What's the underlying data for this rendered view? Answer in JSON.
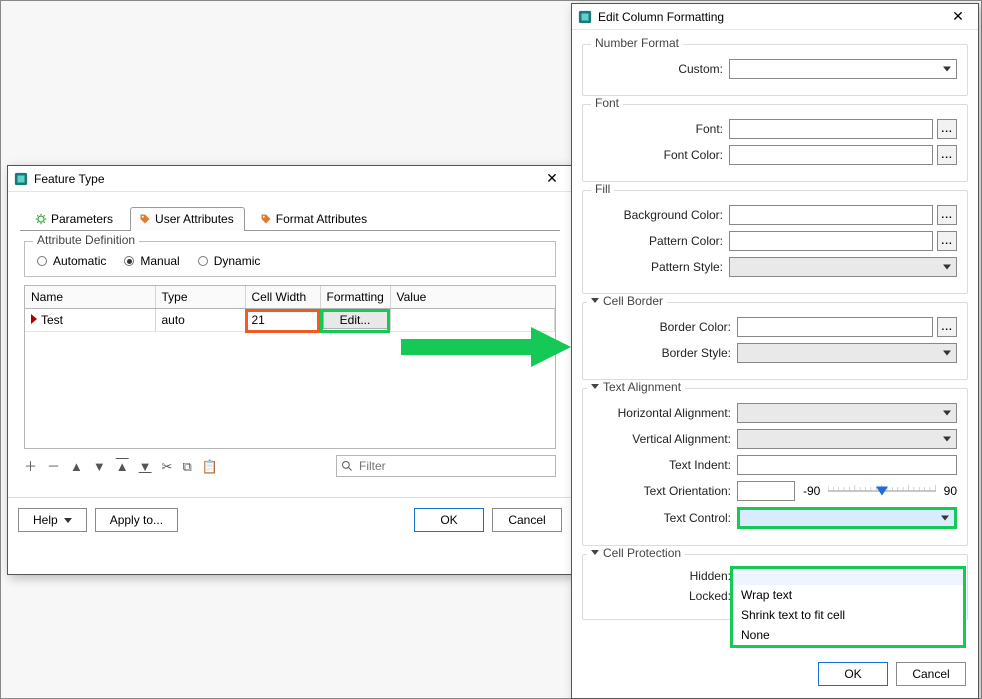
{
  "feature_type": {
    "title": "Feature Type",
    "tabs": {
      "parameters": "Parameters",
      "user_attributes": "User Attributes",
      "format_attributes": "Format Attributes",
      "active": "user_attributes"
    },
    "attr_def": {
      "legend": "Attribute Definition",
      "modes": {
        "automatic": "Automatic",
        "manual": "Manual",
        "dynamic": "Dynamic"
      },
      "selected": "manual"
    },
    "table": {
      "columns": {
        "name": "Name",
        "type": "Type",
        "cell_width": "Cell Width",
        "formatting": "Formatting",
        "value": "Value"
      },
      "rows": [
        {
          "name": "Test",
          "type": "auto",
          "cell_width": "21",
          "formatting": "Edit..."
        }
      ]
    },
    "filter_placeholder": "Filter",
    "buttons": {
      "help": "Help",
      "apply_to": "Apply to...",
      "ok": "OK",
      "cancel": "Cancel"
    }
  },
  "ecf": {
    "title": "Edit Column Formatting",
    "sections": {
      "number_format": {
        "title": "Number Format",
        "custom_label": "Custom:"
      },
      "font": {
        "title": "Font",
        "font_label": "Font:",
        "font_color_label": "Font Color:"
      },
      "fill": {
        "title": "Fill",
        "bg_label": "Background Color:",
        "pat_color_label": "Pattern Color:",
        "pat_style_label": "Pattern Style:"
      },
      "cell_border": {
        "title": "Cell Border",
        "border_color_label": "Border Color:",
        "border_style_label": "Border Style:"
      },
      "text_alignment": {
        "title": "Text Alignment",
        "halign_label": "Horizontal Alignment:",
        "valign_label": "Vertical Alignment:",
        "indent_label": "Text Indent:",
        "orient_label": "Text Orientation:",
        "orient_min": "-90",
        "orient_max": "90",
        "text_control_label": "Text Control:",
        "text_control_options": [
          "Wrap text",
          "Shrink text to fit cell",
          "None"
        ]
      },
      "cell_protection": {
        "title": "Cell Protection",
        "hidden_label": "Hidden:",
        "locked_label": "Locked:"
      }
    },
    "buttons": {
      "ok": "OK",
      "cancel": "Cancel"
    },
    "ellipsis": "..."
  }
}
